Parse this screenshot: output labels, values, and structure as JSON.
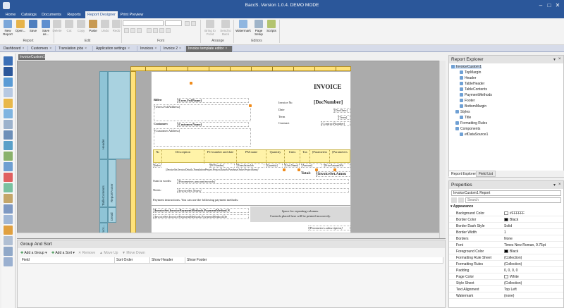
{
  "window": {
    "title": "BaccS. Version 1.0.4. DEMO MODE",
    "controls": [
      "–",
      "□",
      "✕"
    ]
  },
  "ribbon_tabs": [
    "Home",
    "Catalogs",
    "Documents",
    "Reports",
    "Report Designer",
    "Print Preview"
  ],
  "ribbon": {
    "buttons": [
      {
        "label": "New Report"
      },
      {
        "label": "Open..."
      },
      {
        "label": "Save"
      },
      {
        "label": "Save as..."
      },
      {
        "label": "Delete"
      },
      {
        "label": "Cut"
      },
      {
        "label": "Copy"
      },
      {
        "label": "Paste"
      },
      {
        "label": "Undo"
      },
      {
        "label": "Redo"
      },
      {
        "label": "Bring to Front"
      },
      {
        "label": "Send to Back"
      },
      {
        "label": "Watermark"
      },
      {
        "label": "Page Setup"
      },
      {
        "label": "Scripts"
      }
    ],
    "groups": [
      "Report",
      "Edit",
      "Font",
      "Arrange",
      "Editors"
    ]
  },
  "doc_tabs": [
    "Dashboard",
    "Customers",
    "Translation jobs",
    "Application settings",
    "Invoices",
    "Invoice 2",
    "Invoice template editor"
  ],
  "sub_tab": "InvoiceCustom1",
  "report": {
    "invoice_title": "INVOICE",
    "biller_label": "Biller:",
    "biller_value": "[Users.FullName]",
    "user_address": "[Users.FullAddress]",
    "customer_label": "Customer:",
    "customer_value": "[Customer.Name]",
    "customer_address": "[Customer.Address]",
    "invoice_no_label": "Invoice №:",
    "invoice_no_value": "[DocNumber]",
    "date_label": "Date",
    "date_value": "[DocDate]",
    "term_label": "Term",
    "term_value": "[Term]",
    "contract_label": "Contract",
    "contract_value": "[ContractNumber]",
    "table_headers": [
      "№",
      "Description",
      "P.O number and date",
      "PM name",
      "Quantity",
      "Units",
      "Tax",
      "[Parameters",
      "[Parameters"
    ],
    "detail_row": [
      "[Index]",
      "[PONumber]",
      "[TranslationJob",
      "[Quantity]",
      "[Unit.Name]",
      "[Amount]",
      "[PriceAmountWit"
    ],
    "detail_subrow": "[InvoiceSet.InvoiceDetails.TranslationProject.ProjectDetails.PurchaseOrder.ProjectName]",
    "total_label": "Total:",
    "total_value": "[InvoiceSet.Amou",
    "sum_in_words": "Sum in words:",
    "sum_in_words_value": "[Parameters.amountinwords]",
    "notes_label": "Notes:",
    "notes_value": "[InvoiceSet.Notes]",
    "payment_instructions": "Payment instructions. You can use the following payment methods:",
    "payment_method_name": "[InvoiceSet.InvoicePaymentMethods.PaymentMethod.N",
    "payment_method_details": "[InvoiceSet.InvoicePaymentMethods.PaymentMethod.De",
    "space_note_1": "Space for repeating columns.",
    "space_note_2": "Controls placed here will be printed incorrectly.",
    "footer_sub": "[Parameters.subscription]",
    "bands": {
      "header": "Header",
      "table_contents": "TableContents",
      "report_footer": "ReportFooter",
      "detail": "Detail",
      "foot": "Foot..."
    }
  },
  "group_sort": {
    "title": "Group And Sort",
    "tools": [
      "Add a Group",
      "Add a Sort",
      "Remove",
      "Move Up",
      "Move Down"
    ],
    "columns": [
      "Field",
      "Sort Order",
      "Show Header",
      "Show Footer"
    ]
  },
  "report_explorer": {
    "title": "Report Explorer",
    "items": [
      {
        "label": "InvoiceCustom1",
        "indent": 0
      },
      {
        "label": "TopMargin",
        "indent": 2
      },
      {
        "label": "Header",
        "indent": 2
      },
      {
        "label": "TableHeader",
        "indent": 2
      },
      {
        "label": "TableContents",
        "indent": 2
      },
      {
        "label": "PaymentMethods",
        "indent": 2
      },
      {
        "label": "Footer",
        "indent": 2
      },
      {
        "label": "BottomMargin",
        "indent": 2
      },
      {
        "label": "Styles",
        "indent": 1
      },
      {
        "label": "Title",
        "indent": 2
      },
      {
        "label": "Formatting Rules",
        "indent": 1
      },
      {
        "label": "Components",
        "indent": 1
      },
      {
        "label": "efDataSource1",
        "indent": 2
      }
    ],
    "tabs": [
      "Report Explorer",
      "Field List"
    ]
  },
  "properties": {
    "title": "Properties",
    "selected_object": "InvoiceCustom1  Report",
    "search_placeholder": "Search",
    "category": "Appearance",
    "rows": [
      {
        "name": "Background Color",
        "value": "#FFFFFF",
        "swatch": "#ffffff"
      },
      {
        "name": "Border Color",
        "value": "Black",
        "swatch": "#000000"
      },
      {
        "name": "Border Dash Style",
        "value": "Solid",
        "swatch": ""
      },
      {
        "name": "Border Width",
        "value": "1",
        "swatch": ""
      },
      {
        "name": "Borders",
        "value": "None",
        "swatch": ""
      },
      {
        "name": "Font",
        "value": "Times New Roman, 9.75pt",
        "swatch": ""
      },
      {
        "name": "Foreground Color",
        "value": "Black",
        "swatch": "#000000"
      },
      {
        "name": "Formatting Rule Sheet",
        "value": "(Collection)",
        "swatch": ""
      },
      {
        "name": "Formatting Rules",
        "value": "(Collection)",
        "swatch": ""
      },
      {
        "name": "Padding",
        "value": "0, 0, 0, 0",
        "swatch": ""
      },
      {
        "name": "Page Color",
        "value": "White",
        "swatch": "#ffffff"
      },
      {
        "name": "Style Sheet",
        "value": "(Collection)",
        "swatch": ""
      },
      {
        "name": "Text Alignment",
        "value": "Top Left",
        "swatch": ""
      },
      {
        "name": "Watermark",
        "value": "(none)",
        "swatch": ""
      }
    ]
  },
  "colors": {
    "titlebar": "#2b579a",
    "band": "#8fc4d6",
    "ruler": "#ffe27a",
    "table_header": "#fff3a8",
    "handle": "#f08c1c"
  }
}
